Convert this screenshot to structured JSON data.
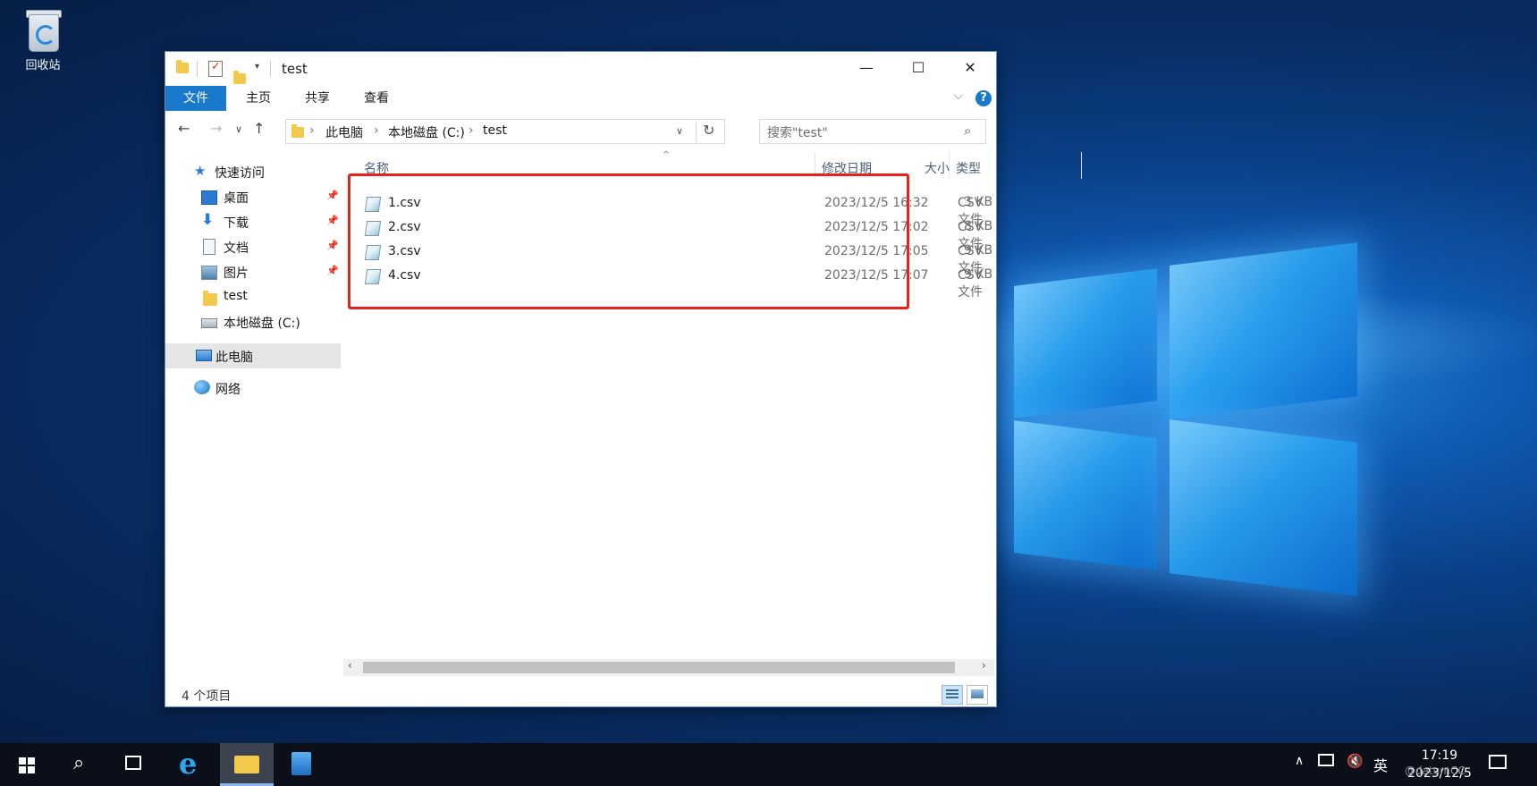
{
  "desktop": {
    "recycle_bin_label": "回收站"
  },
  "window": {
    "title": "test",
    "controls": {
      "minimize": "—",
      "maximize": "☐",
      "close": "✕"
    },
    "ribbon_tabs": [
      "文件",
      "主页",
      "共享",
      "查看"
    ],
    "address": {
      "segments": [
        "此电脑",
        "本地磁盘 (C:)",
        "test"
      ]
    },
    "search": {
      "placeholder": "搜索\"test\""
    },
    "nav": [
      {
        "label": "快速访问",
        "icon": "star-icon",
        "pinned": false
      },
      {
        "label": "桌面",
        "icon": "desktop-icon",
        "pinned": true
      },
      {
        "label": "下载",
        "icon": "download-icon",
        "pinned": true
      },
      {
        "label": "文档",
        "icon": "document-icon",
        "pinned": true
      },
      {
        "label": "图片",
        "icon": "picture-icon",
        "pinned": true
      },
      {
        "label": "test",
        "icon": "folder-icon",
        "pinned": false
      },
      {
        "label": "本地磁盘 (C:)",
        "icon": "drive-icon",
        "pinned": false
      },
      {
        "label": "此电脑",
        "icon": "computer-icon",
        "pinned": false,
        "selected": true
      },
      {
        "label": "网络",
        "icon": "network-icon",
        "pinned": false
      }
    ],
    "columns": [
      "名称",
      "修改日期",
      "类型",
      "大小"
    ],
    "files": [
      {
        "name": "1.csv",
        "modified": "2023/12/5 16:32",
        "type": "CSV 文件",
        "size": "3 KB"
      },
      {
        "name": "2.csv",
        "modified": "2023/12/5 17:02",
        "type": "CSV 文件",
        "size": "8 KB"
      },
      {
        "name": "3.csv",
        "modified": "2023/12/5 17:05",
        "type": "CSV 文件",
        "size": "9 KB"
      },
      {
        "name": "4.csv",
        "modified": "2023/12/5 17:07",
        "type": "CSV 文件",
        "size": "9 KB"
      }
    ],
    "status": {
      "item_count": "4 个项目"
    }
  },
  "taskbar": {
    "tray_ime": "英",
    "clock_time": "17:19",
    "clock_date": "2023/12/5",
    "watermark": "@datumCC"
  },
  "colors": {
    "accent": "#1979ca",
    "highlight_box": "#e8221b",
    "selection": "#e5e5e5"
  }
}
